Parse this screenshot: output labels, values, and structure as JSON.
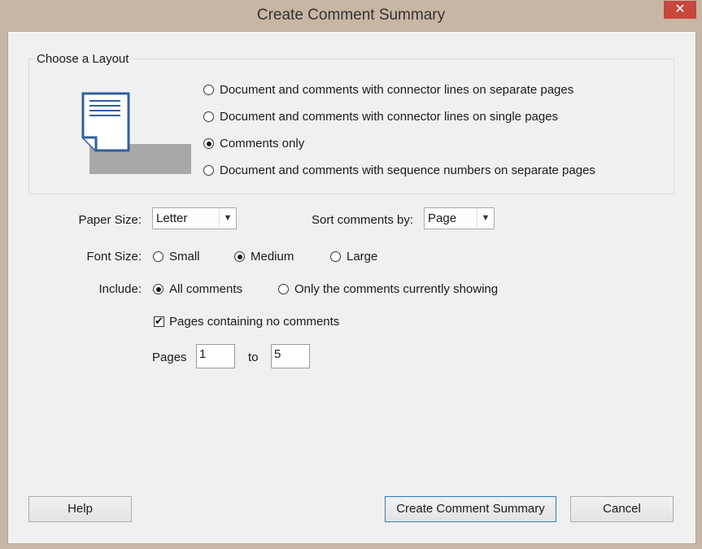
{
  "window": {
    "title": "Create Comment Summary",
    "close_label": "✕"
  },
  "layout_group": {
    "label": "Choose a Layout",
    "options": [
      {
        "label": "Document and comments with connector lines on separate pages",
        "checked": false
      },
      {
        "label": "Document and comments with connector lines on single pages",
        "checked": false
      },
      {
        "label": "Comments only",
        "checked": true
      },
      {
        "label": "Document and comments with sequence numbers on separate pages",
        "checked": false
      }
    ]
  },
  "paper_size": {
    "label": "Paper Size:",
    "value": "Letter"
  },
  "sort_by": {
    "label": "Sort comments by:",
    "value": "Page"
  },
  "font_size": {
    "label": "Font Size:",
    "options": [
      {
        "label": "Small",
        "checked": false
      },
      {
        "label": "Medium",
        "checked": true
      },
      {
        "label": "Large",
        "checked": false
      }
    ]
  },
  "include": {
    "label": "Include:",
    "options": [
      {
        "label": "All comments",
        "checked": true
      },
      {
        "label": "Only the comments currently showing",
        "checked": false
      }
    ]
  },
  "pages_no_comments": {
    "label": "Pages containing no comments",
    "checked": true
  },
  "pages_range": {
    "label": "Pages",
    "from": "1",
    "to_label": "to",
    "to": "5"
  },
  "buttons": {
    "help": "Help",
    "create": "Create Comment Summary",
    "cancel": "Cancel"
  },
  "colors": {
    "frame": "#c8b6a4",
    "close_button": "#c7463d",
    "dialog_bg": "#f0f0f0",
    "doc_icon_border": "#2f5fa0"
  }
}
